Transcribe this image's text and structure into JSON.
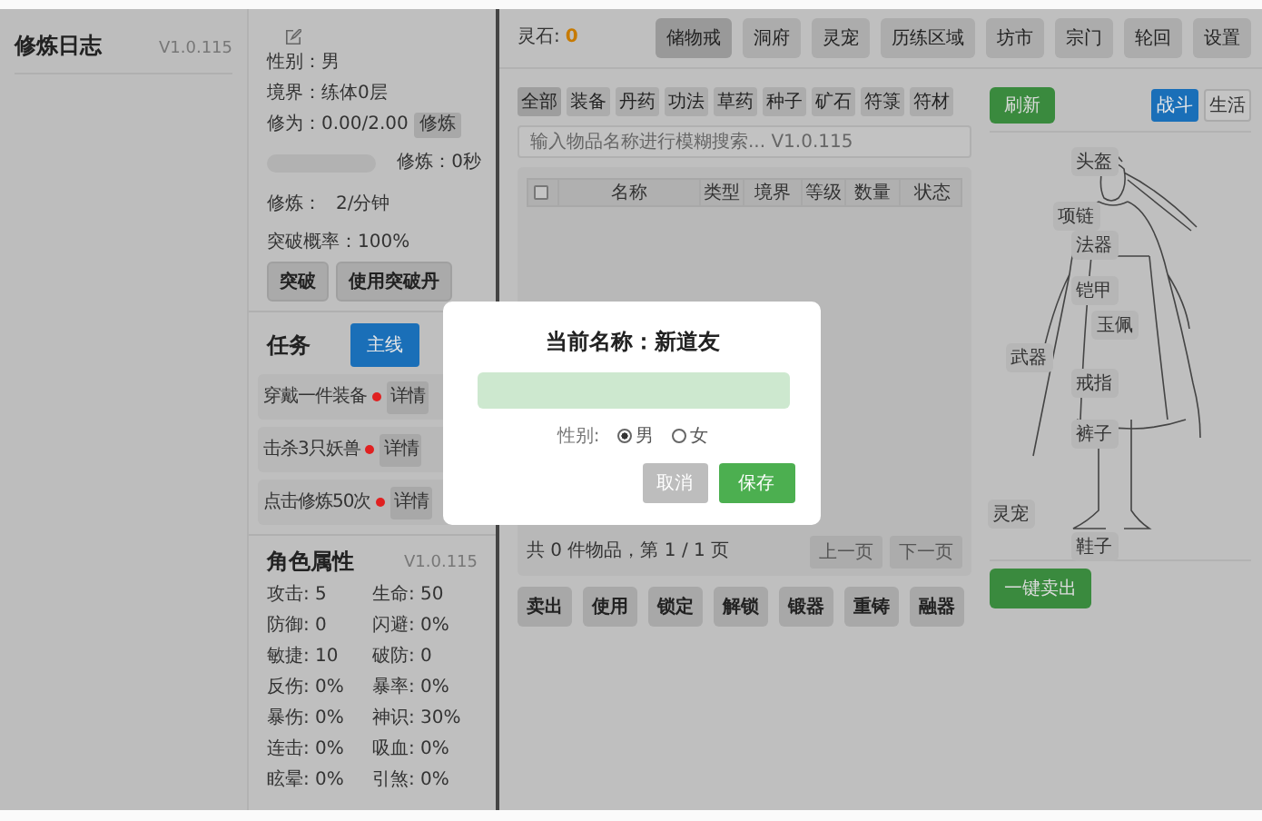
{
  "log_panel": {
    "title": "修炼日志",
    "version": "V1.0.115"
  },
  "character": {
    "gender": "性别：男",
    "realm": "境界：练体0层",
    "cultivation": "修为：0.00/2.00",
    "cultivate_button": "修炼",
    "progress": {
      "level": 0,
      "reading": "修炼：0秒"
    },
    "rate_label": "修炼：",
    "rate_value": "2/分钟",
    "breakthrough_chance": "突破概率：100%",
    "buttons": [
      "突破",
      "使用突破丹"
    ]
  },
  "tasks": {
    "title": "任务",
    "tabs": [
      {
        "label": "主线",
        "selected": true
      }
    ],
    "items": [
      {
        "text": "穿戴一件装备",
        "color": "#e02020",
        "button": "详情"
      },
      {
        "text": "击杀3只妖兽",
        "color": "#e02020",
        "button": "详情"
      },
      {
        "text": "点击修炼50次",
        "color": "#e02020",
        "button": "详情"
      }
    ]
  },
  "attributes": {
    "title": "角色属性",
    "version": "V1.0.115",
    "stats": [
      "攻击: 5",
      "生命: 50",
      "防御: 0",
      "闪避: 0%",
      "敏捷: 10",
      "破防: 0",
      "反伤: 0%",
      "暴率: 0%",
      "暴伤: 0%",
      "神识: 30%",
      "连击: 0%",
      "吸血: 0%",
      "眩晕: 0%",
      "引煞: 0%"
    ]
  },
  "top_bar": {
    "currency_label": "灵石:",
    "currency_value": "0",
    "nav": [
      {
        "label": "储物戒",
        "selected": true
      },
      {
        "label": "洞府",
        "selected": false
      },
      {
        "label": "灵宠",
        "selected": false
      },
      {
        "label": "历练区域",
        "selected": false
      },
      {
        "label": "坊市",
        "selected": false
      },
      {
        "label": "宗门",
        "selected": false
      },
      {
        "label": "轮回",
        "selected": false
      },
      {
        "label": "设置",
        "selected": false
      }
    ]
  },
  "inventory": {
    "filters": [
      {
        "label": "全部",
        "selected": true
      },
      {
        "label": "装备",
        "selected": false
      },
      {
        "label": "丹药",
        "selected": false
      },
      {
        "label": "功法",
        "selected": false
      },
      {
        "label": "草药",
        "selected": false
      },
      {
        "label": "种子",
        "selected": false
      },
      {
        "label": "矿石",
        "selected": false
      },
      {
        "label": "符箓",
        "selected": false
      },
      {
        "label": "符材",
        "selected": false
      }
    ],
    "search": {
      "placeholder": "输入物品名称进行模糊搜索... V1.0.115"
    },
    "table": {
      "select_all_checked": false,
      "columns": [
        "名称",
        "类型",
        "境界",
        "等级",
        "数量",
        "状态"
      ]
    },
    "footer": "共 0 件物品，第 1 / 1 页",
    "pager": [
      "上一页",
      "下一页"
    ],
    "actions": [
      "卖出",
      "使用",
      "锁定",
      "解锁",
      "锻器",
      "重铸",
      "融器"
    ]
  },
  "equipment": {
    "refresh": "刷新",
    "modes": [
      {
        "label": "战斗",
        "selected": true
      },
      {
        "label": "生活",
        "selected": false
      }
    ],
    "slots": [
      "头盔",
      "项链",
      "法器",
      "铠甲",
      "玉佩",
      "武器",
      "戒指",
      "裤子",
      "灵宠",
      "鞋子"
    ],
    "sell_all": "一键卖出"
  },
  "dialog": {
    "title": "当前名称：新道友",
    "gender_label": "性别:",
    "genders": [
      {
        "label": "男",
        "selected": true
      },
      {
        "label": "女",
        "selected": false
      }
    ],
    "buttons": [
      "取消",
      "保存"
    ]
  }
}
